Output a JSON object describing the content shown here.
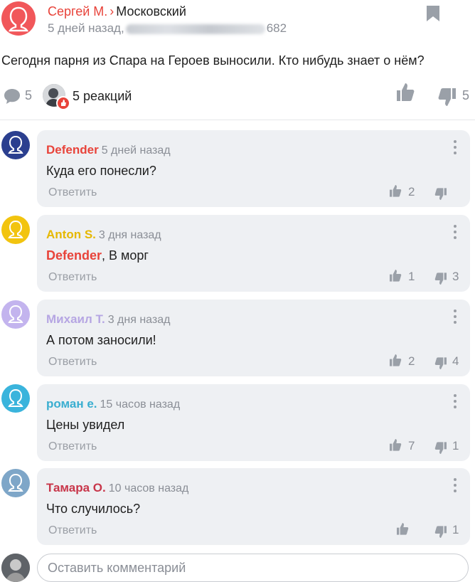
{
  "post": {
    "author": "Сергей М.",
    "arrow": "›",
    "channel": "Московский",
    "time": "5 дней назад,",
    "views": "682",
    "text": "Сегодня парня из Спара на Героев выносили. Кто нибудь знает о нём?",
    "comments_count": "5",
    "reactions_label": "5 реакций",
    "dislike_count": "5"
  },
  "colors": {
    "accent": "#e8433a",
    "bubble": "#eef0f3",
    "muted": "#8a8e96"
  },
  "comments": [
    {
      "name": "Defender",
      "name_color": "#e8433a",
      "time": "5 дней назад",
      "mention": "",
      "text": "Куда его понесли?",
      "reply": "Ответить",
      "likes": "2",
      "dislikes": "",
      "avatar_color": "#2b3f8f"
    },
    {
      "name": "Anton S.",
      "name_color": "#e6b800",
      "time": "3 дня назад",
      "mention": "Defender",
      "text": ", В морг",
      "reply": "Ответить",
      "likes": "1",
      "dislikes": "3",
      "avatar_color": "#f2c40f"
    },
    {
      "name": "Михаил Т.",
      "name_color": "#b6a6e3",
      "time": "3 дня назад",
      "mention": "",
      "text": "А потом заносили!",
      "reply": "Ответить",
      "likes": "2",
      "dislikes": "4",
      "avatar_color": "#c3b4ee"
    },
    {
      "name": "роман е.",
      "name_color": "#3aaed0",
      "time": "15 часов назад",
      "mention": "",
      "text": "Цены увидел",
      "reply": "Ответить",
      "likes": "7",
      "dislikes": "1",
      "avatar_color": "#3ab4dc"
    },
    {
      "name": "Тамара О.",
      "name_color": "#c8364a",
      "time": "10 часов назад",
      "mention": "",
      "text": "Что случилось?",
      "reply": "Ответить",
      "likes": "",
      "dislikes": "1",
      "avatar_color": "#7ea6c8"
    }
  ],
  "compose": {
    "placeholder": "Оставить комментарий"
  },
  "icons": [
    "bookmark-icon",
    "comment-icon",
    "like-icon",
    "dislike-icon",
    "more-icon",
    "person-icon"
  ]
}
